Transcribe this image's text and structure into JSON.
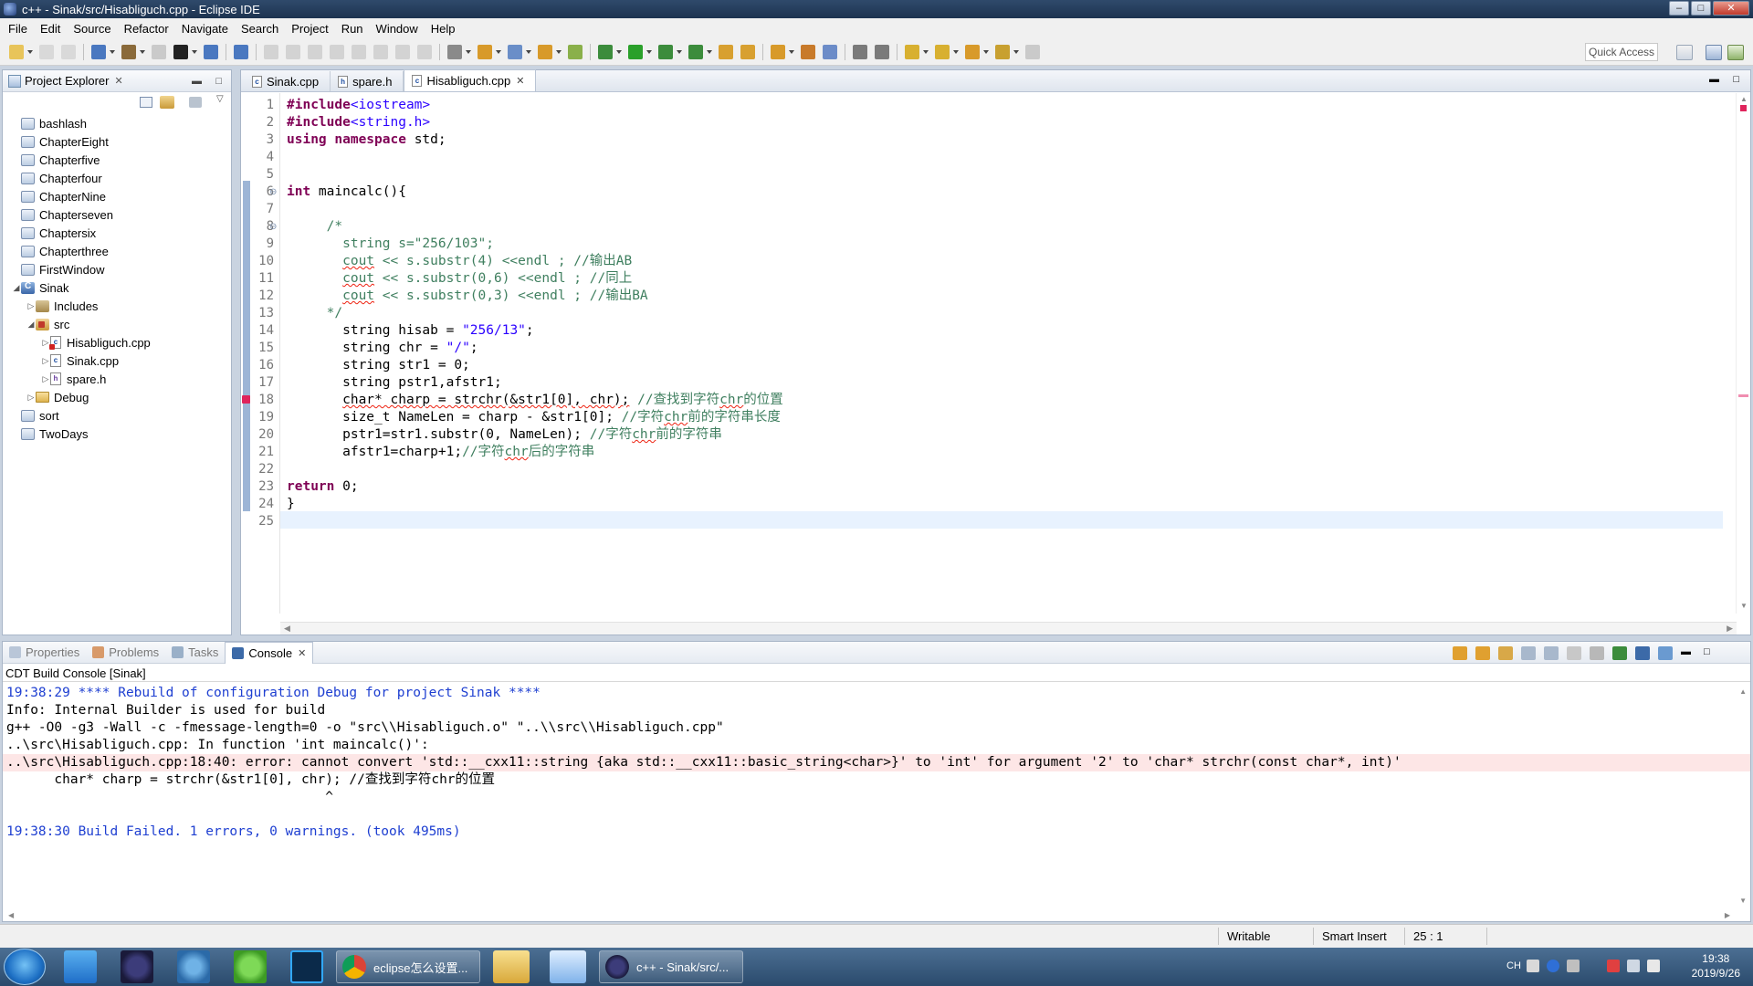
{
  "window": {
    "title": "c++ - Sinak/src/Hisabliguch.cpp - Eclipse IDE"
  },
  "menu": [
    "File",
    "Edit",
    "Source",
    "Refactor",
    "Navigate",
    "Search",
    "Project",
    "Run",
    "Window",
    "Help"
  ],
  "toolbar": {
    "quick_access": "Quick Access"
  },
  "explorer": {
    "tab_label": "Project Explorer",
    "items": [
      {
        "label": "bashlash",
        "type": "project",
        "depth": 0,
        "twisty": ""
      },
      {
        "label": "ChapterEight",
        "type": "project",
        "depth": 0,
        "twisty": ""
      },
      {
        "label": "Chapterfive",
        "type": "project",
        "depth": 0,
        "twisty": ""
      },
      {
        "label": "Chapterfour",
        "type": "project",
        "depth": 0,
        "twisty": ""
      },
      {
        "label": "ChapterNine",
        "type": "project",
        "depth": 0,
        "twisty": ""
      },
      {
        "label": "Chapterseven",
        "type": "project",
        "depth": 0,
        "twisty": ""
      },
      {
        "label": "Chaptersix",
        "type": "project",
        "depth": 0,
        "twisty": ""
      },
      {
        "label": "Chapterthree",
        "type": "project",
        "depth": 0,
        "twisty": ""
      },
      {
        "label": "FirstWindow",
        "type": "project",
        "depth": 0,
        "twisty": ""
      },
      {
        "label": "Sinak",
        "type": "cproject",
        "depth": 0,
        "twisty": "◢"
      },
      {
        "label": "Includes",
        "type": "includes",
        "depth": 1,
        "twisty": "▷"
      },
      {
        "label": "src",
        "type": "src",
        "depth": 1,
        "twisty": "◢"
      },
      {
        "label": "Hisabliguch.cpp",
        "type": "cppfile-err",
        "depth": 2,
        "twisty": "▷"
      },
      {
        "label": "Sinak.cpp",
        "type": "cppfile",
        "depth": 2,
        "twisty": "▷"
      },
      {
        "label": "spare.h",
        "type": "hfile",
        "depth": 2,
        "twisty": "▷"
      },
      {
        "label": "Debug",
        "type": "debug",
        "depth": 1,
        "twisty": "▷"
      },
      {
        "label": "sort",
        "type": "project",
        "depth": 0,
        "twisty": ""
      },
      {
        "label": "TwoDays",
        "type": "project",
        "depth": 0,
        "twisty": ""
      }
    ]
  },
  "editor": {
    "tabs": [
      {
        "label": "Sinak.cpp",
        "active": false,
        "icon": "c"
      },
      {
        "label": "spare.h",
        "active": false,
        "icon": "h"
      },
      {
        "label": "Hisabliguch.cpp",
        "active": true,
        "icon": "c"
      }
    ],
    "lines": [
      [
        [
          "kw",
          "#include"
        ],
        [
          "str",
          "<iostream>"
        ]
      ],
      [
        [
          "kw",
          "#include"
        ],
        [
          "str",
          "<string.h>"
        ]
      ],
      [
        [
          "kw",
          "using"
        ],
        [
          "",
          " "
        ],
        [
          "kw",
          "namespace"
        ],
        [
          "",
          " std;"
        ]
      ],
      [],
      [],
      [
        [
          "kw",
          "int"
        ],
        [
          "",
          " maincalc(){"
        ]
      ],
      [],
      [
        [
          "cm",
          "     /*"
        ]
      ],
      [
        [
          "cm",
          "       string s=\"256/103\";"
        ]
      ],
      [
        [
          "cm",
          "       "
        ],
        [
          "cm sq",
          "cout"
        ],
        [
          "cm",
          " << s.substr(4) <<endl ; //输出AB"
        ]
      ],
      [
        [
          "cm",
          "       "
        ],
        [
          "cm sq",
          "cout"
        ],
        [
          "cm",
          " << s.substr(0,6) <<endl ; //同上"
        ]
      ],
      [
        [
          "cm",
          "       "
        ],
        [
          "cm sq",
          "cout"
        ],
        [
          "cm",
          " << s.substr(0,3) <<endl ; //输出BA"
        ]
      ],
      [
        [
          "cm",
          "     */"
        ]
      ],
      [
        [
          "",
          "       string hisab = "
        ],
        [
          "str",
          "\"256/13\""
        ],
        [
          "",
          ";"
        ]
      ],
      [
        [
          "",
          "       string chr = "
        ],
        [
          "str",
          "\"/\""
        ],
        [
          "",
          ";"
        ]
      ],
      [
        [
          "",
          "       string str1 = 0;"
        ]
      ],
      [
        [
          "",
          "       string pstr1,afstr1;"
        ]
      ],
      [
        [
          "",
          "       "
        ],
        [
          "sq",
          "char* charp = strchr(&str1[0], chr);"
        ],
        [
          "cm",
          " //查找到字符"
        ],
        [
          "cm sq",
          "chr"
        ],
        [
          "cm",
          "的位置"
        ]
      ],
      [
        [
          "",
          "       size_t NameLen = charp - &str1[0]; "
        ],
        [
          "cm",
          "//字符"
        ],
        [
          "cm sq",
          "chr"
        ],
        [
          "cm",
          "前的字符串长度"
        ]
      ],
      [
        [
          "",
          "       pstr1=str1.substr(0, NameLen); "
        ],
        [
          "cm",
          "//字符"
        ],
        [
          "cm sq",
          "chr"
        ],
        [
          "cm",
          "前的字符串"
        ]
      ],
      [
        [
          "",
          "       afstr1=charp+1;"
        ],
        [
          "cm",
          "//字符"
        ],
        [
          "cm sq",
          "chr"
        ],
        [
          "cm",
          "后的字符串"
        ]
      ],
      [],
      [
        [
          "kw",
          "return"
        ],
        [
          "",
          " 0;"
        ]
      ],
      [
        [
          "",
          "}"
        ]
      ],
      []
    ]
  },
  "bottom_panel": {
    "tabs": [
      {
        "label": "Properties",
        "active": false
      },
      {
        "label": "Problems",
        "active": false
      },
      {
        "label": "Tasks",
        "active": false
      },
      {
        "label": "Console",
        "active": true
      }
    ],
    "console_title": "CDT Build Console [Sinak]",
    "lines": [
      {
        "text": "19:38:29 **** Rebuild of configuration Debug for project Sinak ****",
        "style": "blue"
      },
      {
        "text": "Info: Internal Builder is used for build",
        "style": ""
      },
      {
        "text": "g++ -O0 -g3 -Wall -c -fmessage-length=0 -o \"src\\\\Hisabliguch.o\" \"..\\\\src\\\\Hisabliguch.cpp\"",
        "style": ""
      },
      {
        "text": "..\\src\\Hisabliguch.cpp: In function 'int maincalc()':",
        "style": ""
      },
      {
        "text": "..\\src\\Hisabliguch.cpp:18:40: error: cannot convert 'std::__cxx11::string {aka std::__cxx11::basic_string<char>}' to 'int' for argument '2' to 'char* strchr(const char*, int)'",
        "style": "err"
      },
      {
        "text": "      char* charp = strchr(&str1[0], chr); //查找到字符chr的位置",
        "style": ""
      },
      {
        "text": "                                        ^",
        "style": ""
      },
      {
        "text": "",
        "style": ""
      },
      {
        "text": "19:38:30 Build Failed. 1 errors, 0 warnings. (took 495ms)",
        "style": "blue"
      }
    ]
  },
  "statusbar": {
    "writable": "Writable",
    "insert_mode": "Smart Insert",
    "position": "25 : 1"
  },
  "taskbar": {
    "chrome_label": "eclipse怎么设置...",
    "eclipse_label": "c++ - Sinak/src/...",
    "clock_time": "19:38",
    "clock_date": "2019/9/26",
    "ime": "CH"
  }
}
